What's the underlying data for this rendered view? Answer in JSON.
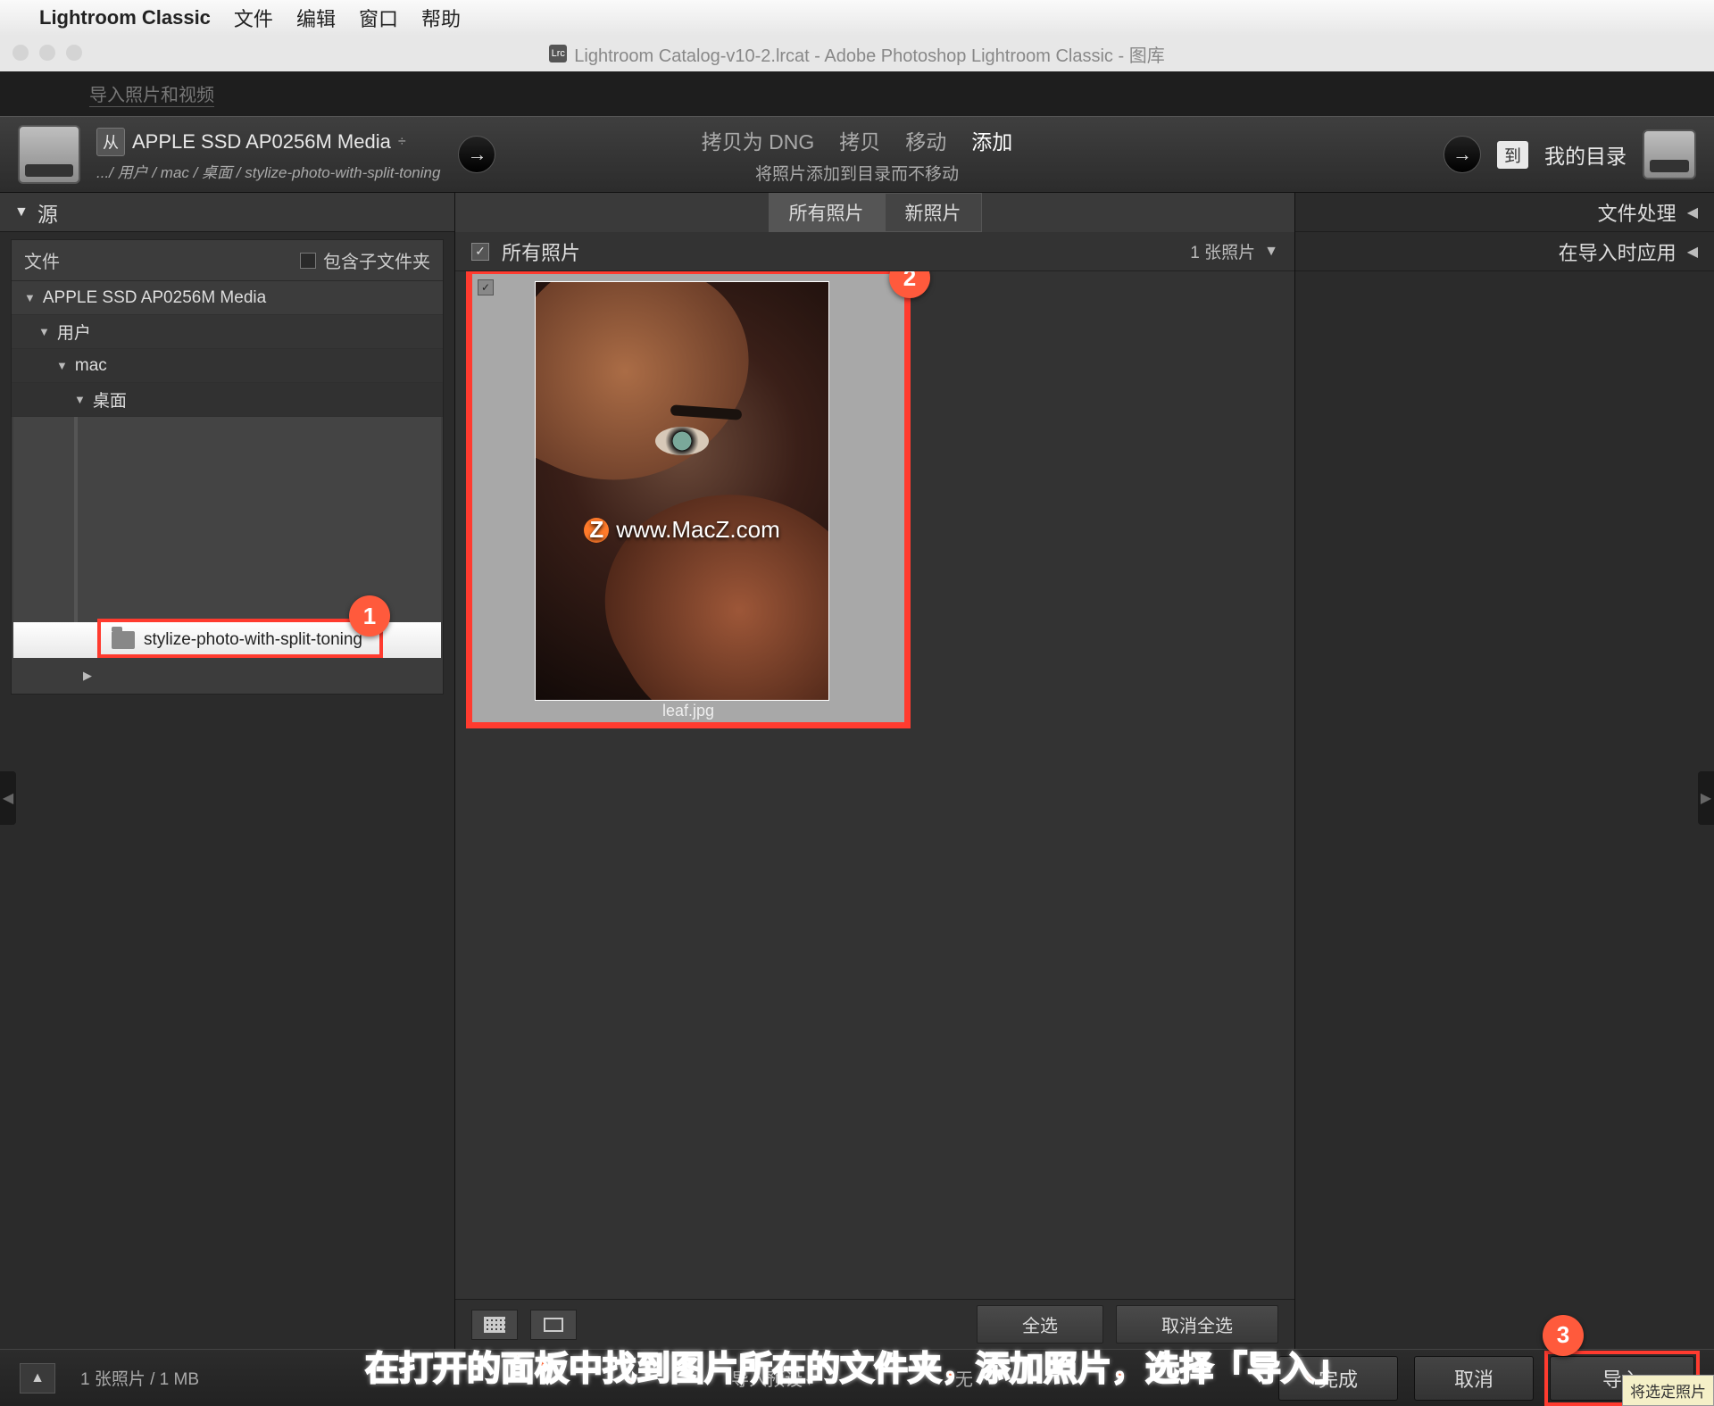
{
  "mac_menu": {
    "app_name": "Lightroom Classic",
    "items": [
      "文件",
      "编辑",
      "窗口",
      "帮助"
    ]
  },
  "window": {
    "title": "Lightroom Catalog-v10-2.lrcat - Adobe Photoshop Lightroom Classic - 图库",
    "icon_text": "Lrc"
  },
  "top_strip": {
    "label": "导入照片和视频"
  },
  "import_header": {
    "from_badge": "从",
    "source_name": "APPLE SSD AP0256M Media",
    "source_path": ".../ 用户 / mac / 桌面 / stylize-photo-with-split-toning",
    "actions": {
      "copy_dng": "拷贝为 DNG",
      "copy": "拷贝",
      "move": "移动",
      "add": "添加"
    },
    "subtitle": "将照片添加到目录而不移动",
    "to_badge": "到",
    "dest_label": "我的目录"
  },
  "left_panel": {
    "source_header": "源",
    "files_label": "文件",
    "include_subfolders": "包含子文件夹",
    "tree": {
      "drive": "APPLE SSD AP0256M Media",
      "l1": "用户",
      "l2": "mac",
      "l3": "桌面",
      "selected": "stylize-photo-with-split-toning"
    }
  },
  "mid_panel": {
    "tabs": {
      "all": "所有照片",
      "new": "新照片"
    },
    "subheader": {
      "title": "所有照片",
      "count": "1 张照片"
    },
    "thumb": {
      "filename": "leaf.jpg",
      "watermark": "www.MacZ.com",
      "wm_icon": "Z"
    },
    "footer": {
      "select_all": "全选",
      "deselect_all": "取消全选"
    }
  },
  "right_panel": {
    "row1": "文件处理",
    "row2": "在导入时应用"
  },
  "bottom_bar": {
    "status": "1 张照片 / 1 MB",
    "preset_label": "导入预设",
    "preset_value": "无",
    "done": "完成",
    "cancel": "取消",
    "import": "导入",
    "tooltip": "将选定照片"
  },
  "annotations": {
    "n1": "1",
    "n2": "2",
    "n3": "3",
    "instruction": "在打开的面板中找到图片所在的文件夹，添加照片，选择「导入」"
  }
}
